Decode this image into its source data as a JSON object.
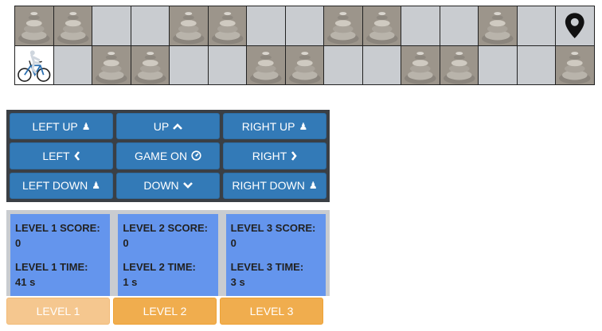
{
  "board": {
    "rows": [
      [
        "rock",
        "rock",
        "empty",
        "empty",
        "rock",
        "rock",
        "empty",
        "empty",
        "rock",
        "rock",
        "empty",
        "empty",
        "rock",
        "empty",
        "goal"
      ],
      [
        "player",
        "empty",
        "rock",
        "rock",
        "empty",
        "empty",
        "rock",
        "rock",
        "empty",
        "empty",
        "rock",
        "rock",
        "empty",
        "empty",
        "rock"
      ]
    ],
    "icons": {
      "rock": "stacked-stones-icon",
      "player": "cyclist-icon",
      "goal": "map-pin-icon"
    }
  },
  "controls": [
    {
      "name": "left-up-button",
      "label": "LEFT UP",
      "icon": "♟"
    },
    {
      "name": "up-button",
      "label": "UP",
      "icon": "⌃"
    },
    {
      "name": "right-up-button",
      "label": "RIGHT UP",
      "icon": "♟"
    },
    {
      "name": "left-button",
      "label": "LEFT",
      "icon": "‹"
    },
    {
      "name": "game-on-button",
      "label": "GAME ON",
      "icon": "◷"
    },
    {
      "name": "right-button",
      "label": "RIGHT",
      "icon": "›"
    },
    {
      "name": "left-down-button",
      "label": "LEFT DOWN",
      "icon": "♟"
    },
    {
      "name": "down-button",
      "label": "DOWN",
      "icon": "⌄"
    },
    {
      "name": "right-down-button",
      "label": "RIGHT DOWN",
      "icon": "♟"
    }
  ],
  "scores": [
    {
      "score_label": "LEVEL 1 SCORE:",
      "score": "0",
      "time_label": "LEVEL 1 TIME:",
      "time": "41 s"
    },
    {
      "score_label": "LEVEL 2 SCORE:",
      "score": "0",
      "time_label": "LEVEL 2 TIME:",
      "time": "1 s"
    },
    {
      "score_label": "LEVEL 3 SCORE:",
      "score": "0",
      "time_label": "LEVEL 3 TIME:",
      "time": "3 s"
    }
  ],
  "levels": [
    {
      "label": "LEVEL 1",
      "active": true
    },
    {
      "label": "LEVEL 2",
      "active": false
    },
    {
      "label": "LEVEL 3",
      "active": false
    }
  ],
  "colors": {
    "board_empty": "#c9ccd0",
    "control_button": "#337ab7",
    "control_panel": "#3a3f45",
    "score_card": "#6495ed",
    "level_button": "#f0ad4e",
    "level_button_active": "#f5c78f"
  }
}
